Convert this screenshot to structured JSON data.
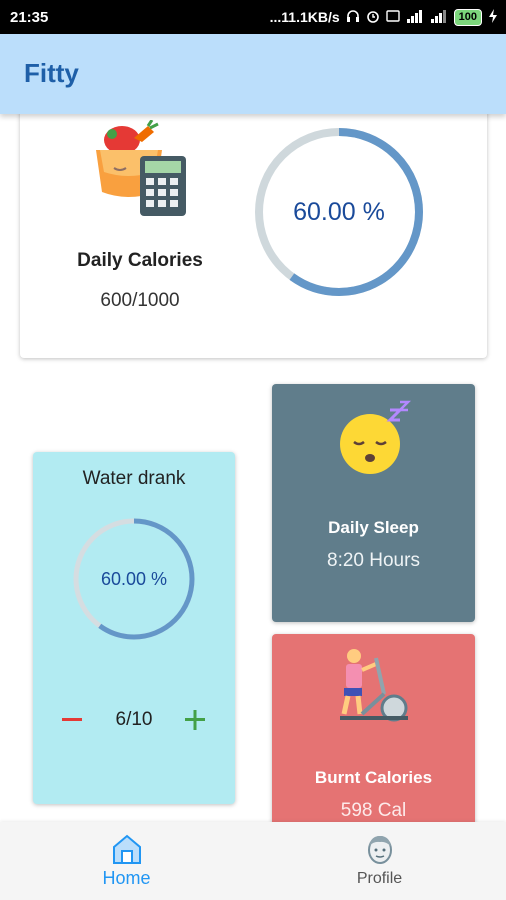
{
  "status_bar": {
    "time": "21:35",
    "network_speed": "...11.1KB/s",
    "battery": "100"
  },
  "app_bar": {
    "title": "Fitty"
  },
  "calories": {
    "label": "Daily Calories",
    "value": "600/1000",
    "percent_text": "60.00 %",
    "progress": 0.6,
    "ring_color": "#6497c8",
    "track_color": "#cfd8dc"
  },
  "water": {
    "title": "Water drank",
    "percent_text": "60.00 %",
    "progress": 0.6,
    "count": "6/10",
    "minus_icon": "minus-icon",
    "plus_icon": "plus-icon"
  },
  "sleep": {
    "label": "Daily Sleep",
    "value": "8:20 Hours",
    "icon": "sleeping-face-icon"
  },
  "burnt": {
    "label": "Burnt Calories",
    "value": "598 Cal",
    "icon": "elliptical-trainer-icon"
  },
  "bottom_nav": {
    "home_label": "Home",
    "profile_label": "Profile",
    "active": "Home"
  },
  "colors": {
    "app_bar": "#bbdefb",
    "water_card": "#b2ebf2",
    "sleep_card": "#607d8b",
    "burnt_card": "#e57373",
    "active_nav": "#2196f3"
  }
}
